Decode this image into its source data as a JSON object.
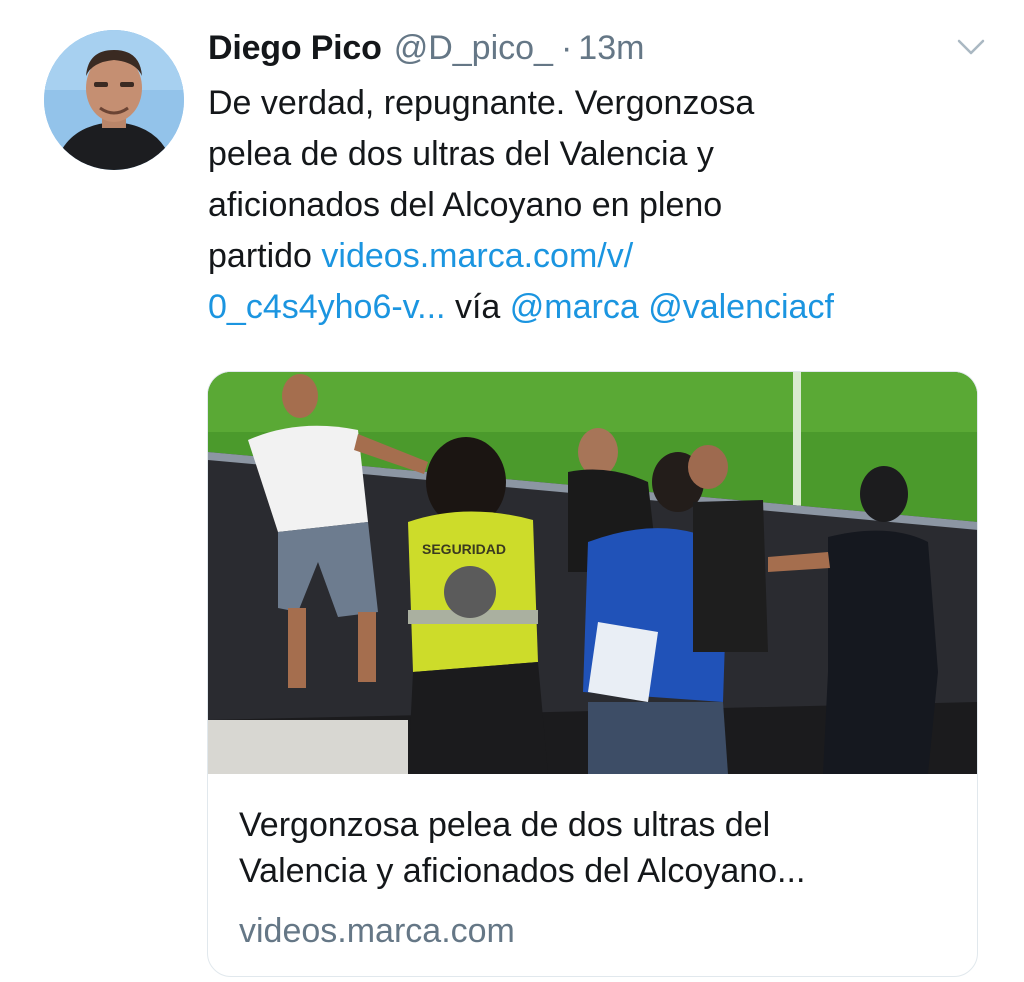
{
  "tweet": {
    "author_name": "Diego Pico",
    "author_handle": "@D_pico_",
    "separator": "·",
    "time": "13m",
    "text": {
      "line1": "De verdad,  repugnante. Vergonzosa",
      "line2": "pelea de dos ultras del Valencia y",
      "line3": "aficionados del Alcoyano en pleno",
      "line4_text": "partido ",
      "line4_link": "videos.marca.com/v/",
      "line5_link": "0_c4s4yho6-v...",
      "line5_text": " vía ",
      "mention1": "@marca",
      "mention_sep": " ",
      "mention2": "@valenciacf"
    },
    "caret_icon": "chevron-down-icon",
    "avatar_icon": "profile-photo"
  },
  "card": {
    "image_label": "SEGURIDAD",
    "title_line1": "Vergonzosa pelea de dos ultras del",
    "title_line2": "Valencia y aficionados del Alcoyano...",
    "domain": "videos.marca.com"
  },
  "colors": {
    "link": "#1b95e0",
    "secondary_text": "#657786",
    "primary_text": "#14171a",
    "card_border": "#e1e8ed"
  }
}
